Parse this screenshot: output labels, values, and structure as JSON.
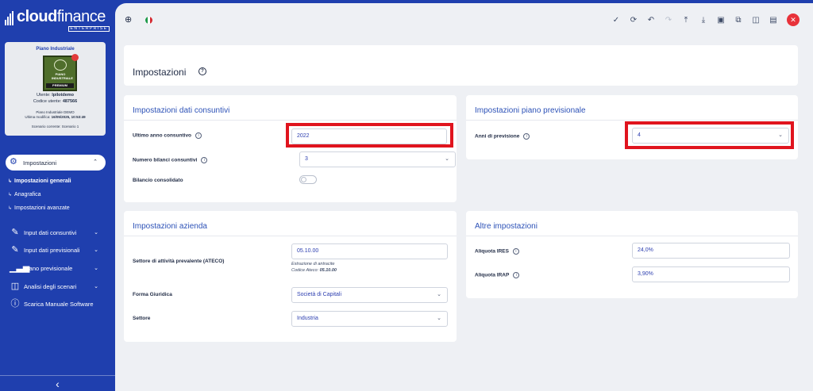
{
  "brand": {
    "name_bold": "cloud",
    "name_light": "finance",
    "edition": "ENTERPRISE"
  },
  "plan_card": {
    "title": "Piano Industriale",
    "image_lines": [
      "PIANO",
      "INDUSTRIALE"
    ],
    "image_badge": "PREMIUM",
    "user_label": "Utente:",
    "user": "lpilotdemo",
    "code_label": "Codice utente:",
    "code": "487566",
    "plan_name": "Piano Industriale DEMO",
    "last_modified_label": "Ultima modifica:",
    "last_modified": "16/05/2025, 10:53:49",
    "scenario": "Scenario corrente: Scenario 1"
  },
  "sidebar": {
    "section": {
      "label": "Impostazioni",
      "icon": "gear-icon"
    },
    "subitems": [
      {
        "label": "Impostazioni generali",
        "active": true
      },
      {
        "label": "Anagrafica",
        "active": false
      },
      {
        "label": "Impostazioni avanzate",
        "active": false
      }
    ],
    "items": [
      {
        "label": "Input dati consuntivi",
        "icon": "edit-icon"
      },
      {
        "label": "Input dati previsionali",
        "icon": "edit-icon"
      },
      {
        "label": "Piano previsionale",
        "icon": "bar-chart-icon"
      },
      {
        "label": "Analisi degli scenari",
        "icon": "columns-icon"
      },
      {
        "label": "Scarica Manuale Software",
        "icon": "help-circle-icon"
      }
    ]
  },
  "toolbar": {
    "icons": [
      "check-icon",
      "refresh-icon",
      "undo-icon",
      "redo-icon",
      "upload-icon",
      "download-icon",
      "save-icon",
      "copy-icon",
      "split-view-icon",
      "table-icon",
      "close-icon"
    ]
  },
  "page": {
    "title": "Impostazioni"
  },
  "consuntivi": {
    "title": "Impostazioni dati consuntivi",
    "ultimo_anno_label": "Ultimo anno consuntivo",
    "ultimo_anno_value": "2022",
    "numero_bilanci_label": "Numero bilanci consuntivi",
    "numero_bilanci_value": "3",
    "bilancio_consolidato_label": "Bilancio consolidato",
    "bilancio_consolidato_on": false
  },
  "previsionale": {
    "title": "Impostazioni piano previsionale",
    "anni_label": "Anni di previsione",
    "anni_value": "4"
  },
  "azienda": {
    "title": "Impostazioni azienda",
    "settore_attivita_label": "Settore di attività prevalente (ATECO)",
    "ateco_value": "05.10.00",
    "ateco_desc": "Estrazione di antracite",
    "ateco_code_label": "Codice Ateco:",
    "ateco_code": "05.10.00",
    "forma_giuridica_label": "Forma Giuridica",
    "forma_giuridica_value": "Società di Capitali",
    "settore_label": "Settore",
    "settore_value": "Industria"
  },
  "altre": {
    "title": "Altre impostazioni",
    "ires_label": "Aliquota IRES",
    "ires_value": "24,0%",
    "irap_label": "Aliquota IRAP",
    "irap_value": "3,90%"
  },
  "colors": {
    "brand_blue": "#1f3fae",
    "accent_blue": "#2d52b7",
    "highlight_red": "#e0141e",
    "close_red": "#e8323a"
  }
}
